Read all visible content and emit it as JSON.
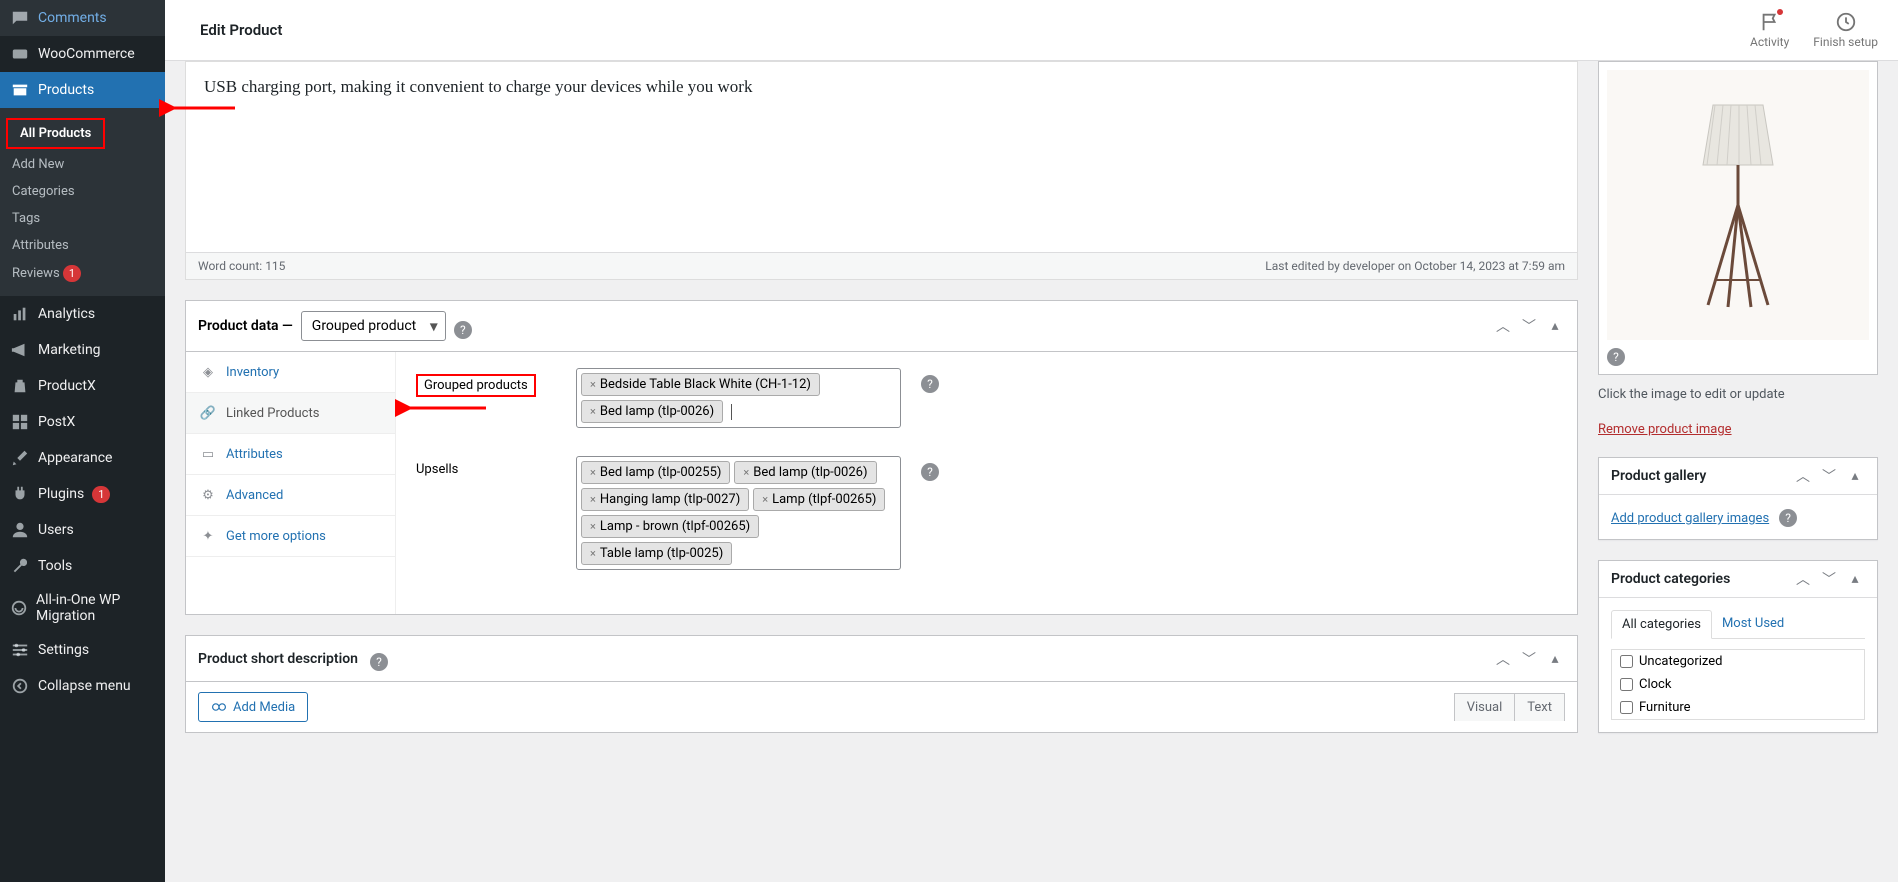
{
  "page_title": "Edit Product",
  "topbar_actions": {
    "activity": "Activity",
    "finish": "Finish setup"
  },
  "sidebar": {
    "comments": "Comments",
    "woocommerce": "WooCommerce",
    "products": "Products",
    "analytics": "Analytics",
    "marketing": "Marketing",
    "productx": "ProductX",
    "postx": "PostX",
    "appearance": "Appearance",
    "plugins": "Plugins",
    "plugins_count": "1",
    "users": "Users",
    "tools": "Tools",
    "aiowp": "All-in-One WP Migration",
    "settings": "Settings",
    "collapse": "Collapse menu",
    "sub": {
      "all_products": "All Products",
      "add_new": "Add New",
      "categories": "Categories",
      "tags": "Tags",
      "attributes": "Attributes",
      "reviews": "Reviews",
      "reviews_count": "1"
    }
  },
  "editor": {
    "text": "USB charging port, making it convenient to charge your devices while you work",
    "word_count_label": "Word count: ",
    "word_count": "115",
    "last_edited": "Last edited by developer on October 14, 2023 at 7:59 am"
  },
  "product_data": {
    "title": "Product data",
    "selected_type": "Grouped product",
    "tabs": {
      "inventory": "Inventory",
      "linked": "Linked Products",
      "attributes": "Attributes",
      "advanced": "Advanced",
      "get_more": "Get more options"
    },
    "grouped_label": "Grouped products",
    "grouped_items": [
      "Bedside Table Black White (CH-1-12)",
      "Bed lamp (tlp-0026)"
    ],
    "upsells_label": "Upsells",
    "upsell_items": [
      "Bed lamp (tlp-00255)",
      "Bed lamp (tlp-0026)",
      "Hanging lamp (tlp-0027)",
      "Lamp (tlpf-00265)",
      "Lamp - brown (tlpf-00265)",
      "Table lamp (tlp-0025)"
    ]
  },
  "short_desc": {
    "title": "Product short description",
    "add_media": "Add Media",
    "visual": "Visual",
    "text_tab": "Text"
  },
  "side": {
    "image_caption": "Click the image to edit or update",
    "remove_image": "Remove product image",
    "gallery_title": "Product gallery",
    "add_gallery": "Add product gallery images",
    "cats_title": "Product categories",
    "cat_tab_all": "All categories",
    "cat_tab_most": "Most Used",
    "cats": [
      "Uncategorized",
      "Clock",
      "Furniture"
    ]
  }
}
